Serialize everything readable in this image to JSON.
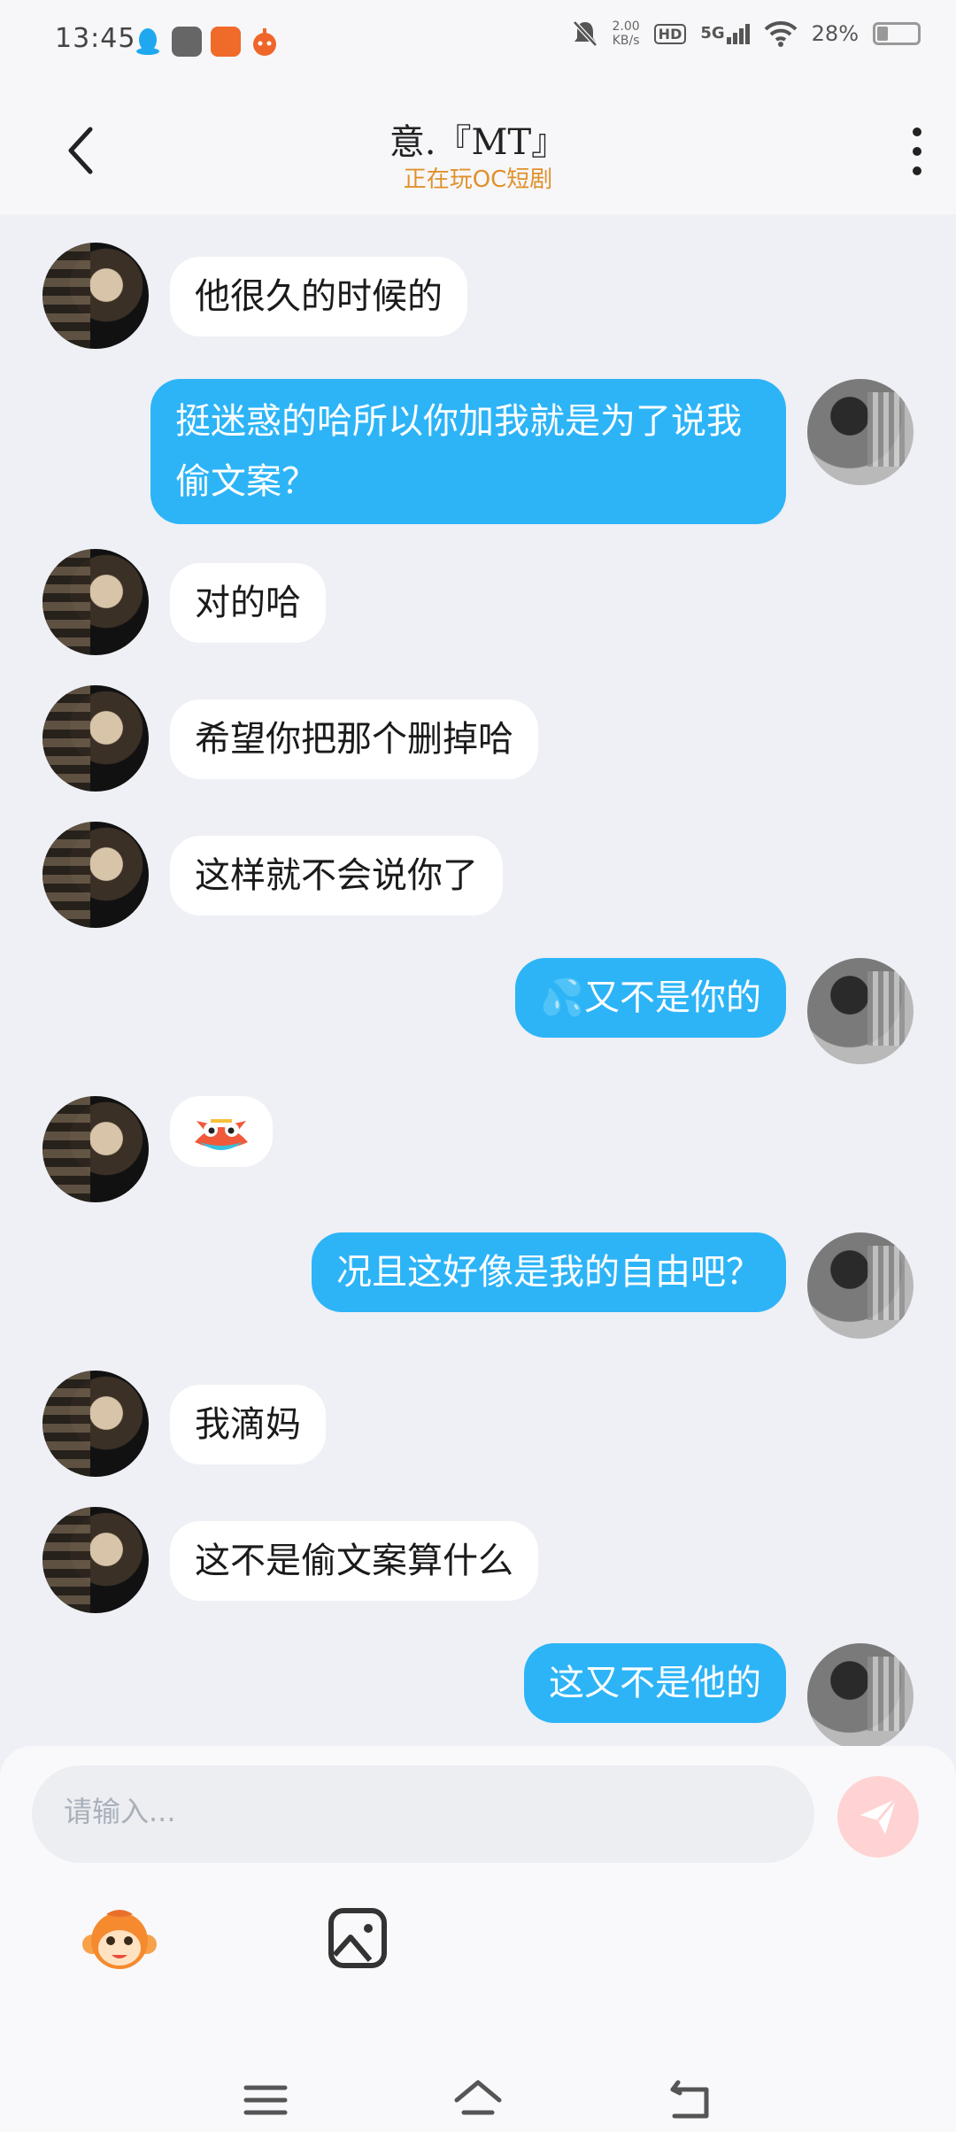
{
  "status_bar": {
    "time": "13:45",
    "speed_value": "2.00",
    "speed_unit": "KB/s",
    "hd": "HD",
    "network": "5G",
    "battery": "28%",
    "battery_level": 0.28
  },
  "header": {
    "title": "意.『MT』",
    "subtitle": "正在玩OC短剧"
  },
  "messages": [
    {
      "from": "them",
      "text": "他很久的时候的"
    },
    {
      "from": "me",
      "text": "挺迷惑的哈所以你加我就是为了说我偷文案？"
    },
    {
      "from": "them",
      "text": "对的哈"
    },
    {
      "from": "them",
      "text": "希望你把那个删掉哈"
    },
    {
      "from": "them",
      "text": "这样就不会说你了"
    },
    {
      "from": "me",
      "emoji": "💦",
      "text": "又不是你的"
    },
    {
      "from": "them",
      "sticker": "tiger-sticker"
    },
    {
      "from": "me",
      "text": "况且这好像是我的自由吧？"
    },
    {
      "from": "them",
      "text": "我滴妈"
    },
    {
      "from": "them",
      "text": "这不是偷文案算什么"
    },
    {
      "from": "me",
      "text": "这又不是他的"
    }
  ],
  "input": {
    "placeholder": "请输入..."
  },
  "colors": {
    "accent": "#2db4f7",
    "subtitle": "#e0912c",
    "background": "#eef0f5"
  }
}
